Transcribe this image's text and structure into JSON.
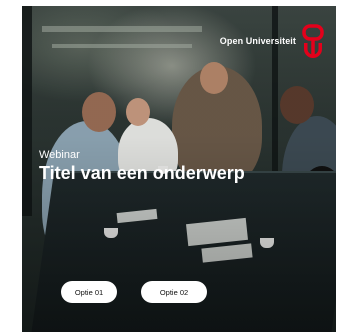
{
  "brand": {
    "name": "Open Universiteit",
    "logo_icon": "ou-logo-icon",
    "accent_color": "#e4001b"
  },
  "hero": {
    "eyebrow": "Webinar",
    "title": "Titel van een onderwerp"
  },
  "actions": [
    {
      "label": "Optie 01"
    },
    {
      "label": "Optie 02"
    }
  ]
}
